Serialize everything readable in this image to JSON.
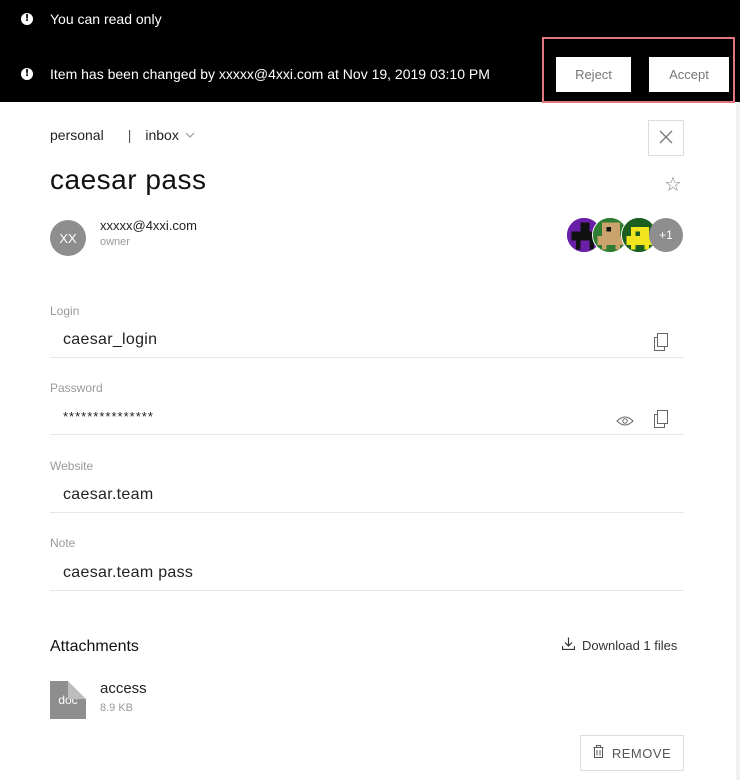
{
  "banner": {
    "readonly_text": "You can read only",
    "changed_text": "Item has been changed by xxxxx@4xxi.com at Nov 19, 2019 03:10 PM",
    "reject_label": "Reject",
    "accept_label": "Accept",
    "alert_glyph": "!"
  },
  "breadcrumb": {
    "vault": "personal",
    "separator": "|",
    "list": "inbox",
    "chevron": "⌵"
  },
  "item": {
    "title": "caesar pass",
    "star_glyph": "☆"
  },
  "owner": {
    "initials": "XX",
    "email": "xxxxx@4xxi.com",
    "role": "owner"
  },
  "members": {
    "more_label": "+1",
    "colors": [
      "#6a1fa8",
      "#2f7d32",
      "#1b5e20"
    ]
  },
  "fields": {
    "login": {
      "label": "Login",
      "value": "caesar_login"
    },
    "password": {
      "label": "Password",
      "value": "***************"
    },
    "website": {
      "label": "Website",
      "value": "caesar.team"
    },
    "note": {
      "label": "Note",
      "value": "caesar.team pass"
    }
  },
  "attachments": {
    "title": "Attachments",
    "download_label": "Download 1 files",
    "files": [
      {
        "type": "doc",
        "name": "access",
        "size": "8.9 KB"
      }
    ],
    "remove_label": "REMOVE"
  },
  "icons": {
    "alert": "alert-icon",
    "close": "close-icon",
    "star": "star-icon",
    "copy": "copy-icon",
    "eye": "eye-icon",
    "download": "download-icon",
    "trash": "trash-icon",
    "doc": "doc-file-icon"
  },
  "colors": {
    "banner_bg": "#000000",
    "highlight_border": "#e4747f",
    "avatar_grey": "#8e8e8e"
  }
}
